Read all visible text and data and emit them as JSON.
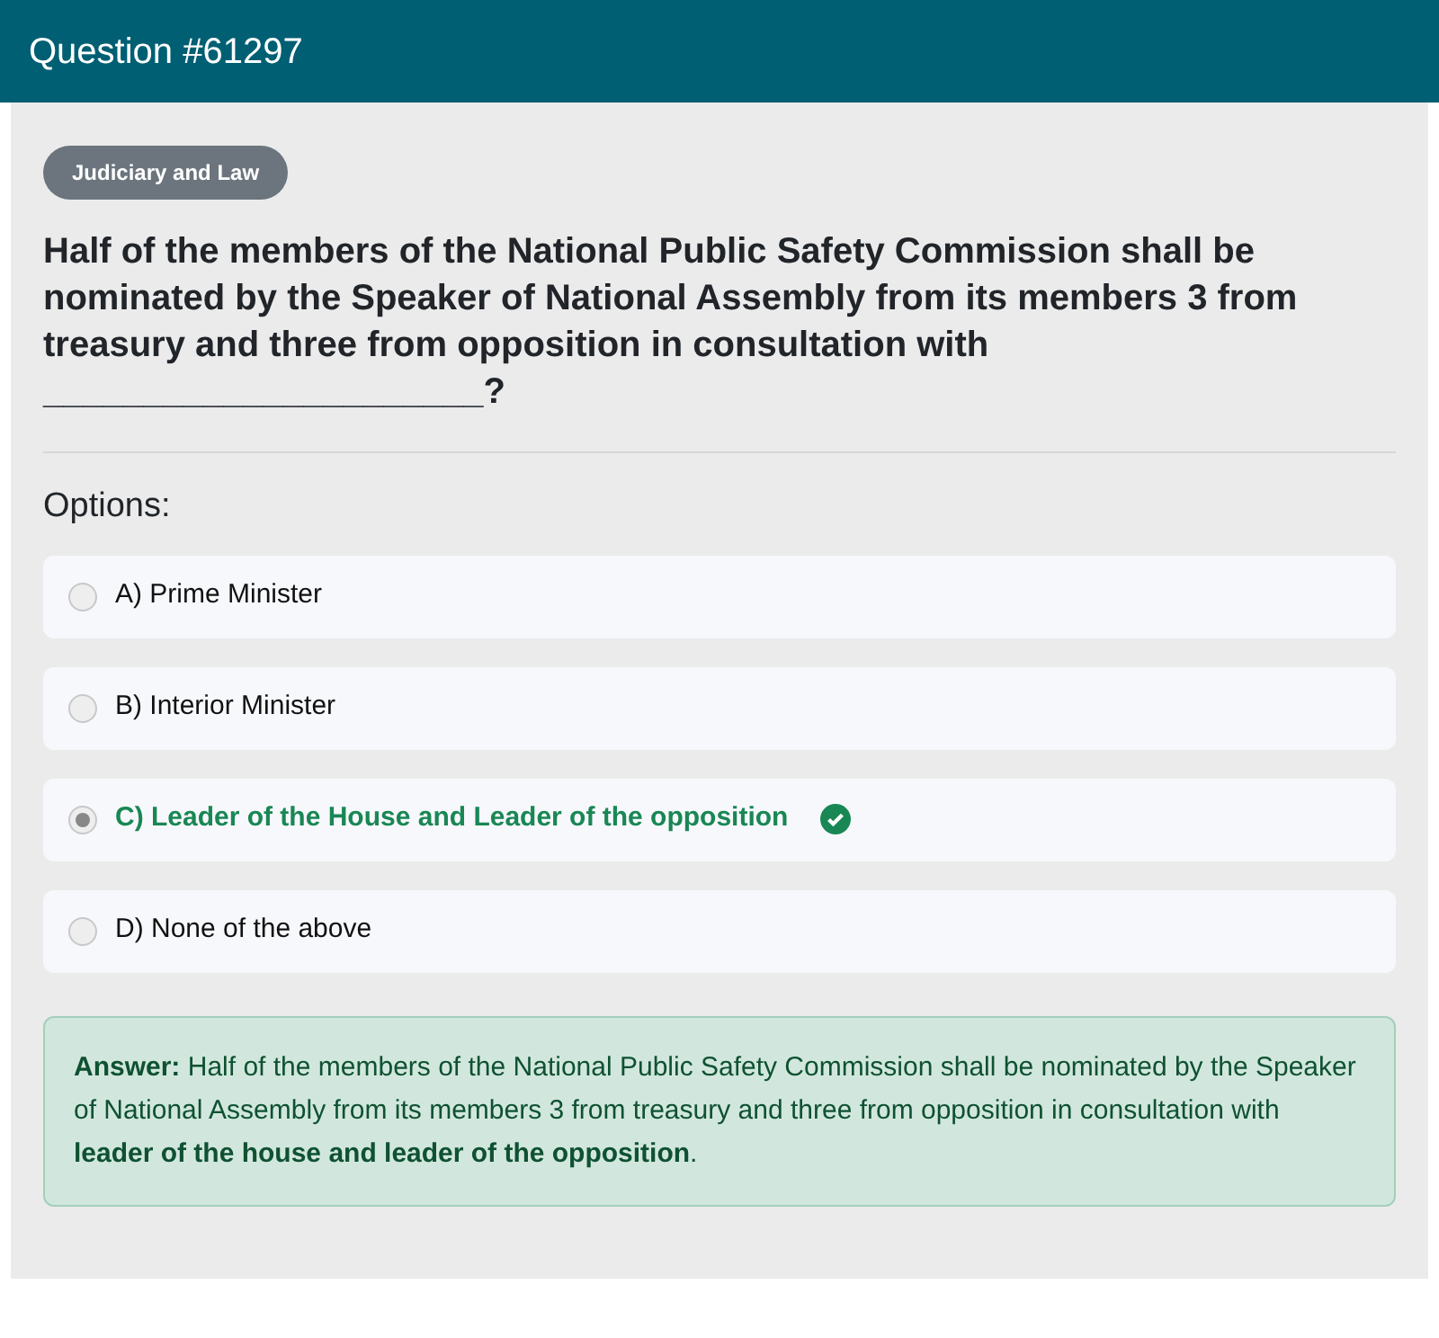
{
  "header": {
    "title": "Question #61297"
  },
  "category": "Judiciary and Law",
  "question": "Half of the members of the National Public Safety Commission shall be nominated by the Speaker of National Assembly from its members 3 from treasury and three from opposition in consultation with ______________________?",
  "options_label": "Options:",
  "options": [
    {
      "label": "A) Prime Minister",
      "selected": false,
      "correct": false
    },
    {
      "label": "B) Interior Minister",
      "selected": false,
      "correct": false
    },
    {
      "label": "C) Leader of the House and Leader of the opposition",
      "selected": true,
      "correct": true
    },
    {
      "label": "D) None of the above",
      "selected": false,
      "correct": false
    }
  ],
  "answer": "**Answer:** Half of the members of the National Public Safety Commission shall be nominated by the Speaker of National Assembly from its members 3 from treasury and three from opposition in consultation with **leader of the house and leader of the opposition**."
}
